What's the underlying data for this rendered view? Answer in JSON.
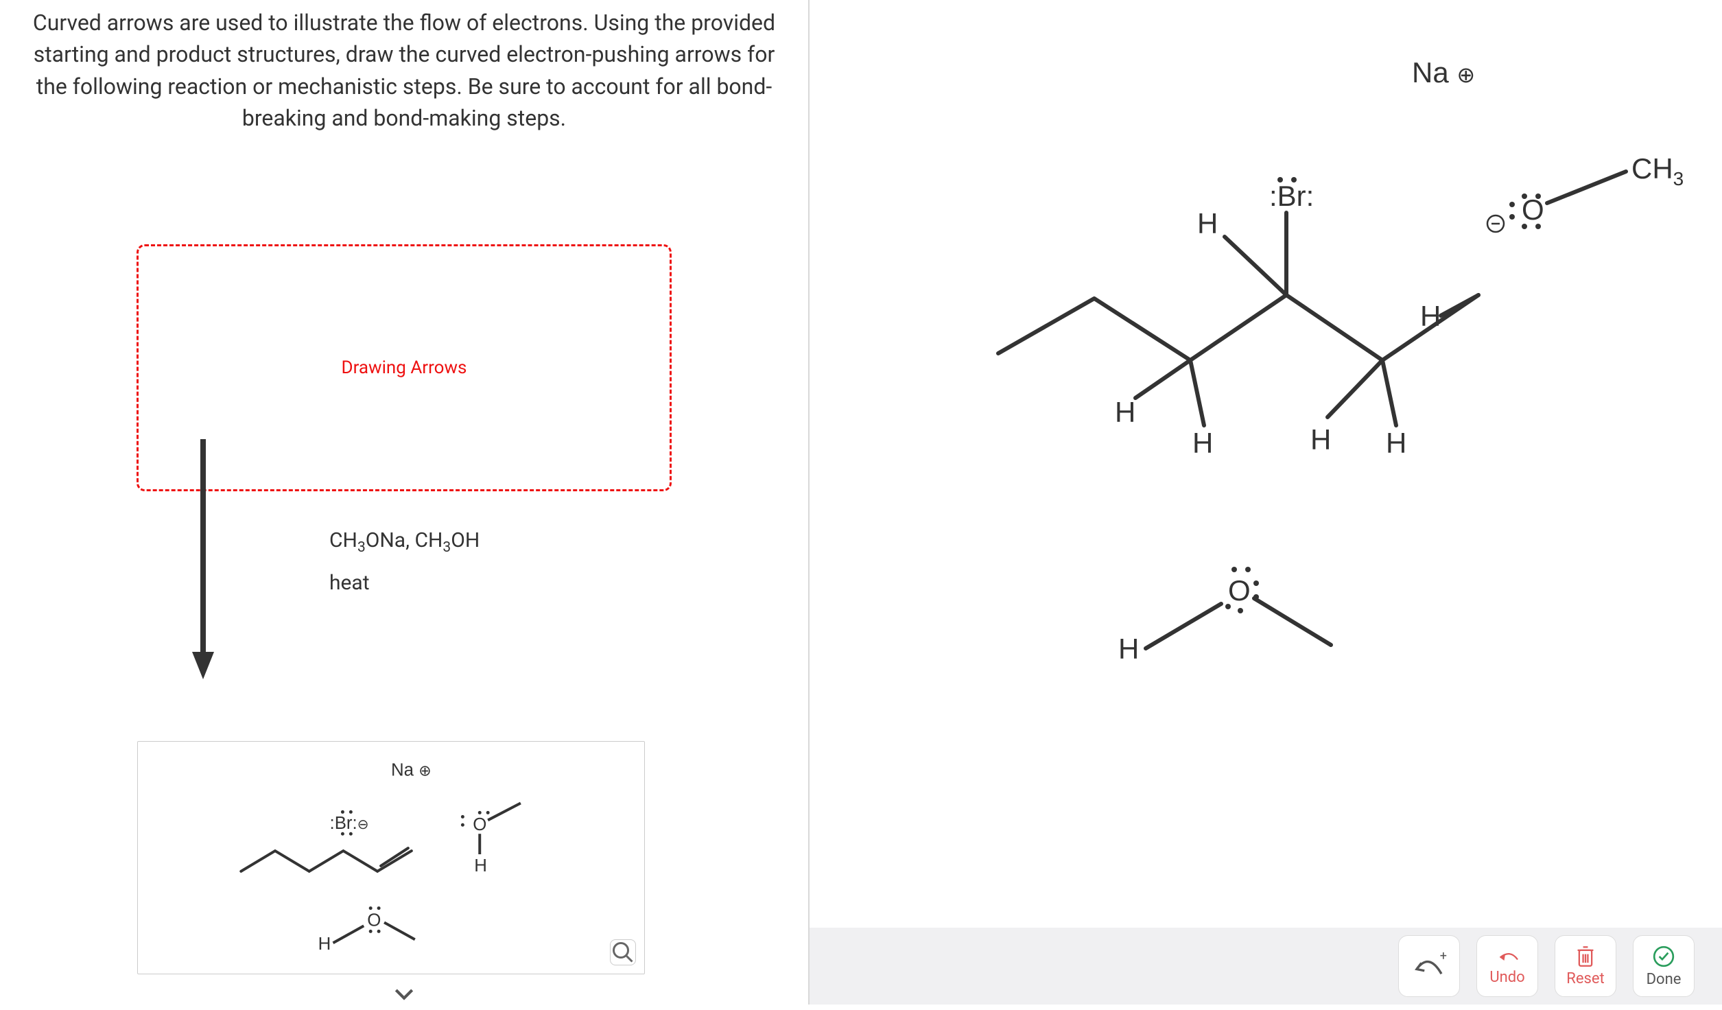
{
  "prompt": "Curved arrows are used to illustrate the flow of electrons. Using the provided starting and product structures, draw the curved electron-pushing arrows for the following reaction or mechanistic steps. Be sure to account for all bond-breaking and bond-making steps.",
  "drawing_box_label": "Drawing Arrows",
  "reagents_line1_html": "CH<sub>3</sub>ONa, CH<sub>3</sub>OH",
  "reagents_line2": "heat",
  "product_card": {
    "na_label_html": "Na ⊕",
    "br_label_html": ":Br:⊖",
    "methoxide_O": "O",
    "methoxide_H": "H",
    "dme_H": "H",
    "dme_O": "O"
  },
  "canvas": {
    "na_html": "Na ⊕",
    "br": ":Br:",
    "H": "H",
    "O": "O",
    "ch3_html": "CH<sub>3</sub>",
    "methoxide_charge": "⊖"
  },
  "toolbar": {
    "undo": "Undo",
    "reset": "Reset",
    "done": "Done"
  }
}
